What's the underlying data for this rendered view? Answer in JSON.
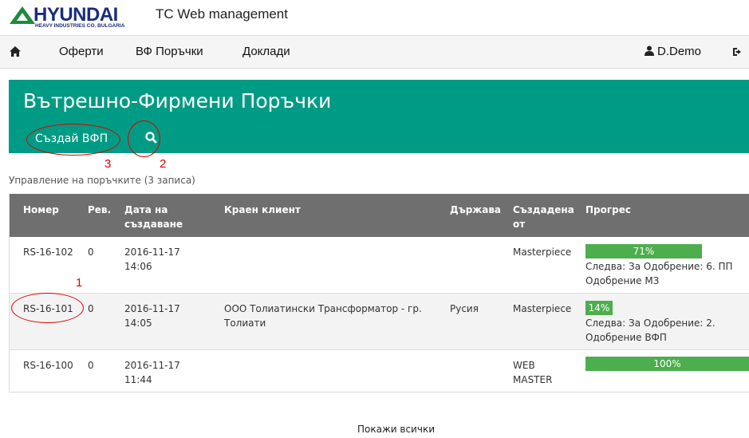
{
  "header": {
    "logo_word": "HYUNDAI",
    "logo_sub": "HEAVY INDUSTRIES CO. BULGARIA",
    "app_title": "TC Web management"
  },
  "nav": {
    "items": [
      {
        "label": "Оферти"
      },
      {
        "label": "ВФ Поръчки"
      },
      {
        "label": "Доклади"
      }
    ],
    "user": "D.Demo"
  },
  "banner": {
    "title": "Вътрешно-Фирмени Поръчки",
    "create_label": "Създай ВФП"
  },
  "annotations": [
    "1",
    "2",
    "3"
  ],
  "subtitle": "Управление на поръчките (3 записа)",
  "table": {
    "columns": [
      "Номер",
      "Рев.",
      "Дата на създаване",
      "Краен клиент",
      "Държава",
      "Създадена от",
      "Прогрес"
    ],
    "rows": [
      {
        "number": "RS-16-102",
        "rev": "0",
        "date": "2016-11-17",
        "time": "14:06",
        "client": "",
        "country": "",
        "created_by": "Masterpiece",
        "progress": 71,
        "progress_label": "71%",
        "next_line1": "Следва: За Одобрение: 6. ПП",
        "next_line2": "Одобрение МЗ"
      },
      {
        "number": "RS-16-101",
        "rev": "0",
        "date": "2016-11-17",
        "time": "14:05",
        "client": "ООО Толиатински Трансформатор - гр. Толиати",
        "country": "Русия",
        "created_by": "Masterpiece",
        "progress": 14,
        "progress_label": "14%",
        "next_line1": "Следва: За Одобрение: 2.",
        "next_line2": "Одобрение ВФП"
      },
      {
        "number": "RS-16-100",
        "rev": "0",
        "date": "2016-11-17",
        "time": "11:44",
        "client": "",
        "country": "",
        "created_by": "WEB MASTER",
        "progress": 100,
        "progress_label": "100%",
        "next_line1": "",
        "next_line2": ""
      }
    ]
  },
  "show_all": "Покажи всички",
  "colors": {
    "banner": "#009b84",
    "header_row": "#6f6f6f",
    "progress": "#4cae4c",
    "annotation": "#e00000",
    "logo_blue": "#1a2d78",
    "logo_green": "#1d8a3c"
  },
  "icons": [
    "home-icon",
    "user-icon",
    "logout-icon",
    "search-icon"
  ]
}
